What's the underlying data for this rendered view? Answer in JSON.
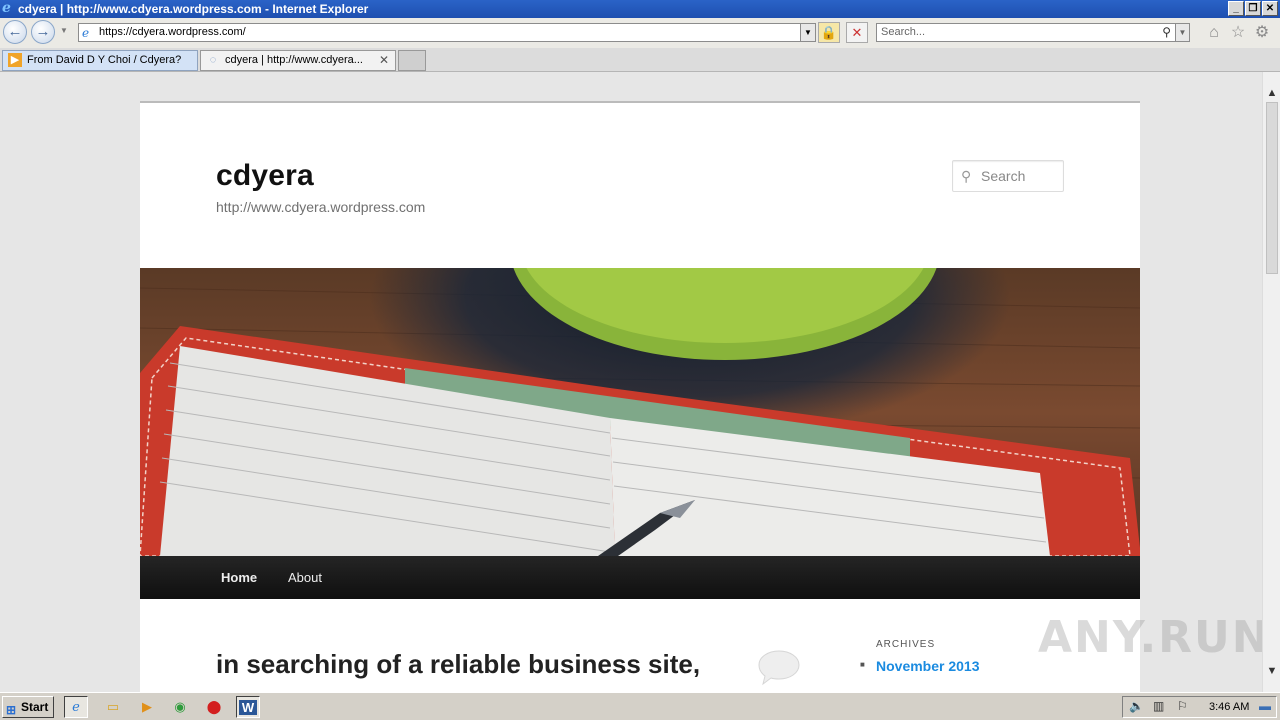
{
  "window": {
    "title": "cdyera | http://www.cdyera.wordpress.com - Internet Explorer",
    "minimize_glyph": "_",
    "maximize_glyph": "❐",
    "close_glyph": "✕"
  },
  "addressbar": {
    "url": "https://cdyera.wordpress.com/",
    "search_placeholder": "Search..."
  },
  "tabs": [
    {
      "label": "From David D Y Choi / Cdyera?"
    },
    {
      "label": "cdyera | http://www.cdyera..."
    }
  ],
  "site": {
    "title": "cdyera",
    "description": "http://www.cdyera.wordpress.com",
    "search_placeholder": "Search",
    "nav": [
      {
        "label": "Home"
      },
      {
        "label": "About"
      }
    ],
    "post_title": "in searching of a reliable business site,",
    "sidebar": {
      "archives_heading": "ARCHIVES",
      "archives": [
        "November 2013"
      ]
    }
  },
  "watermark": "ANY.RUN",
  "taskbar": {
    "start_label": "Start",
    "clock": "3:46 AM"
  },
  "icons": {
    "ie": "ie-icon",
    "back": "back-arrow-icon",
    "forward": "forward-arrow-icon",
    "lock": "lock-icon",
    "stop": "stop-icon",
    "home": "home-icon",
    "favorites": "star-icon",
    "tools": "gear-icon"
  },
  "colors": {
    "link": "#1b8be0",
    "nav_bg": "#1a1a1a",
    "titlebar": "#2a63c7"
  }
}
